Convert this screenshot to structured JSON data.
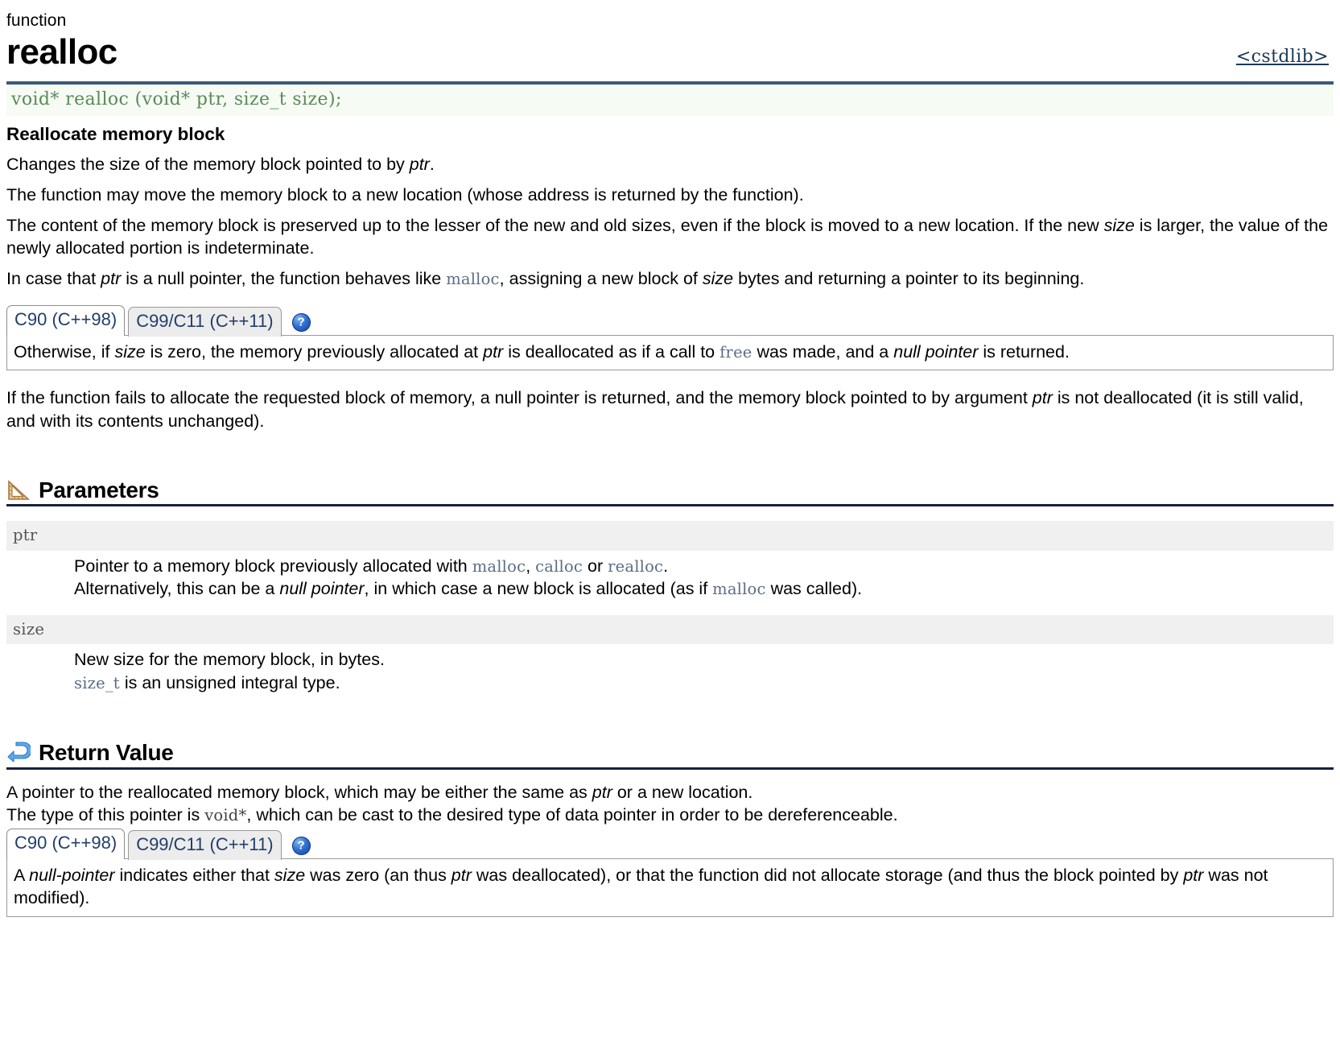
{
  "header": {
    "kind": "function",
    "title": "realloc",
    "header_file": "<cstdlib>",
    "signature": "void* realloc (void* ptr, size_t size);"
  },
  "summary": {
    "title": "Reallocate memory block",
    "p1_a": "Changes the size of the memory block pointed to by ",
    "p1_ptr": "ptr",
    "p1_b": ".",
    "p2": "The function may move the memory block to a new location (whose address is returned by the function).",
    "p3_a": "The content of the memory block is preserved up to the lesser of the new and old sizes, even if the block is moved to a new location. If the new ",
    "p3_size": "size",
    "p3_b": " is larger, the value of the newly allocated portion is indeterminate.",
    "p4_a": "In case that ",
    "p4_ptr": "ptr",
    "p4_b": " is a null pointer, the function behaves like ",
    "p4_malloc": "malloc",
    "p4_c": ", assigning a new block of ",
    "p4_size": "size",
    "p4_d": " bytes and returning a pointer to its beginning.",
    "p5_a": "If the function fails to allocate the requested block of memory, a null pointer is returned, and the memory block pointed to by argument ",
    "p5_ptr": "ptr",
    "p5_b": " is not deallocated (it is still valid, and with its contents unchanged)."
  },
  "tabs_description": {
    "tab1_label": "C90 (C++98)",
    "tab2_label": "C99/C11 (C++11)",
    "help_icon": "help-icon",
    "body_a": "Otherwise, if ",
    "body_size": "size",
    "body_b": " is zero, the memory previously allocated at ",
    "body_ptr": "ptr",
    "body_c": " is deallocated as if a call to ",
    "body_free": "free",
    "body_d": " was made, and a ",
    "body_null": "null pointer",
    "body_e": " is returned."
  },
  "parameters": {
    "section_title": "Parameters",
    "section_icon": "ruler-triangle-icon",
    "items": [
      {
        "name": "ptr",
        "line1_a": "Pointer to a memory block previously allocated with ",
        "line1_malloc": "malloc",
        "line1_sep1": ", ",
        "line1_calloc": "calloc",
        "line1_sep2": " or ",
        "line1_realloc": "realloc",
        "line1_end": ".",
        "line2_a": "Alternatively, this can be a ",
        "line2_em": "null pointer",
        "line2_b": ", in which case a new block is allocated (as if ",
        "line2_malloc": "malloc",
        "line2_c": " was called)."
      },
      {
        "name": "size",
        "line1": "New size for the memory block, in bytes.",
        "line2_code": "size_t",
        "line2_rest": " is an unsigned integral type."
      }
    ]
  },
  "return_value": {
    "section_title": "Return Value",
    "section_icon": "return-arrow-icon",
    "line1_a": "A pointer to the reallocated memory block, which may be either the same as ",
    "line1_ptr": "ptr",
    "line1_b": " or a new location.",
    "line2_a": "The type of this pointer is ",
    "line2_code": "void*",
    "line2_b": ", which can be cast to the desired type of data pointer in order to be dereferenceable.",
    "tab1_label": "C90 (C++98)",
    "tab2_label": "C99/C11 (C++11)",
    "help_icon": "help-icon",
    "body_a": "A ",
    "body_null": "null-pointer",
    "body_b": " indicates either that ",
    "body_size": "size",
    "body_c": " was zero (an thus ",
    "body_ptr": "ptr",
    "body_d": " was deallocated), or that the function did not allocate storage (and thus the block pointed by ",
    "body_ptr2": "ptr",
    "body_e": " was not modified)."
  },
  "colors": {
    "rule": "#3c5a77",
    "signature_text": "#5a8a5a",
    "signature_bg": "#f6fbf3",
    "tab_text": "#213e6b",
    "code_link": "#5b6e86",
    "section_rule": "#19213d"
  }
}
